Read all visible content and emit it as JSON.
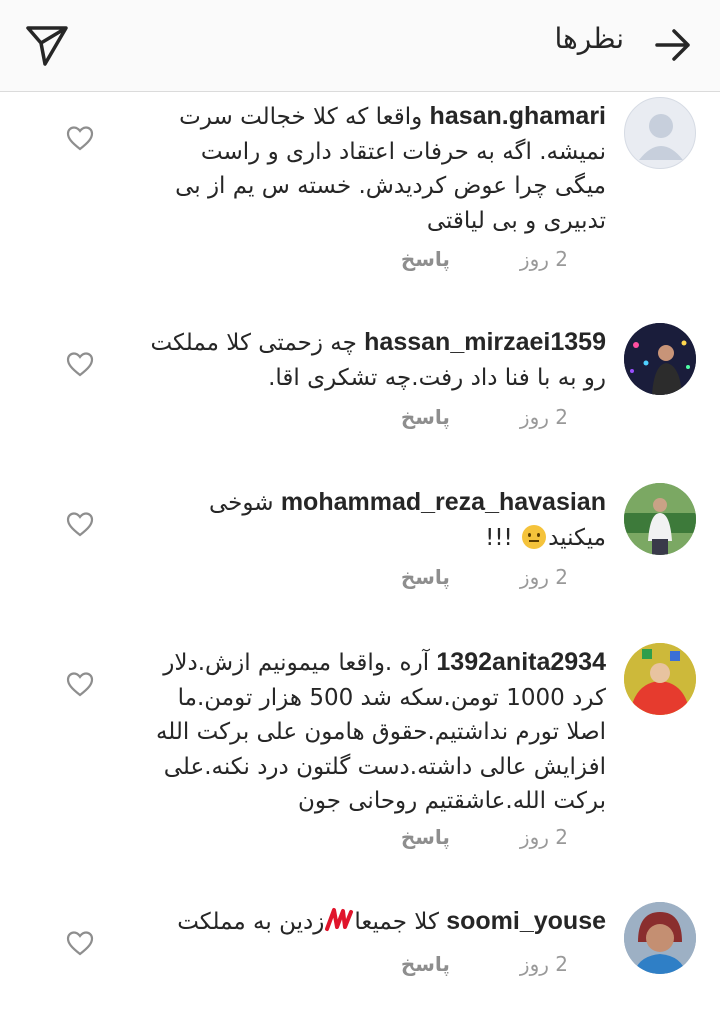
{
  "header": {
    "title": "نظرها",
    "back_icon": "arrow-right-icon",
    "share_icon": "paper-plane-icon"
  },
  "comments": [
    {
      "username": "hasan.ghamari",
      "text": " واقعا که کلا خجالت سرت نمیشه. اگه به حرفات اعتقاد داری و راست میگی چرا عوض کردیدش. خسته س یم از بی تدبیری و بی لیاقتی",
      "time": "2 روز",
      "reply": "پاسخ"
    },
    {
      "username": "hassan_mirzaei1359",
      "text": " چه زحمتی کلا مملکت رو به با فنا داد رفت.چه تشکری اقا.",
      "time": "2 روز",
      "reply": "پاسخ"
    },
    {
      "username": "mohammad_reza_havasian",
      "text_before_emoji": " شوخی میکنید",
      "text_after_emoji": " !!!",
      "time": "2 روز",
      "reply": "پاسخ"
    },
    {
      "username": "1392anita2934",
      "text": " آره .واقعا میمونیم ازش.دلار کرد 1000 تومن.سکه شد 500 هزار تومن.ما اصلا تورم نداشتیم.حقوق هامون علی برکت الله افزایش عالی داشته.دست گلتون درد نکنه.علی برکت الله.عاشقتیم روحانی جون",
      "time": "2 روز",
      "reply": "پاسخ"
    },
    {
      "username": "soomi_youse",
      "text_before_scribble": " کلا جمیعا",
      "text_after_scribble": "زدین به مملکت",
      "time": "2 روز",
      "reply": "پاسخ"
    }
  ],
  "colors": {
    "text": "#262626",
    "meta": "#999999",
    "topbar_bg": "#fafafa",
    "border": "#dbdbdb",
    "scribble": "#e0142b"
  }
}
